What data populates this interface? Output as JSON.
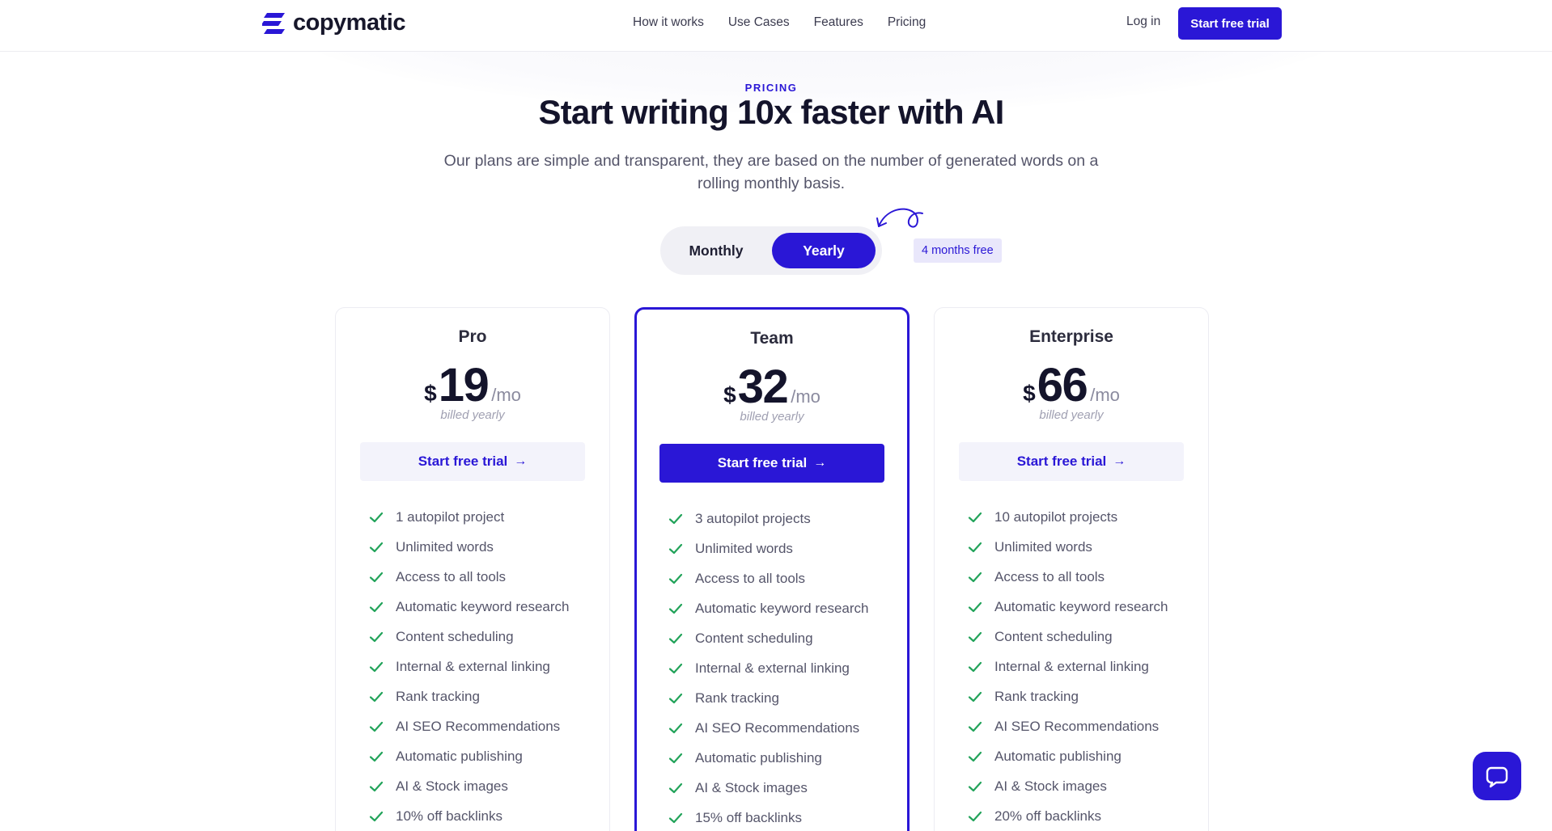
{
  "header": {
    "logo_text": "copymatic",
    "nav": [
      "How it works",
      "Use Cases",
      "Features",
      "Pricing"
    ],
    "login": "Log in",
    "cta": "Start free trial"
  },
  "hero": {
    "eyebrow": "PRICING",
    "title": "Start writing 10x faster with AI",
    "subtitle": "Our plans are simple and transparent, they are based on the number of generated words on a rolling monthly basis."
  },
  "billing_toggle": {
    "monthly": "Monthly",
    "yearly": "Yearly",
    "selected": "Yearly",
    "promo": "4 months free"
  },
  "plans": [
    {
      "name": "Pro",
      "currency": "$",
      "price": "19",
      "period": "/mo",
      "billed": "billed yearly",
      "cta": "Start free trial",
      "features": [
        "1 autopilot project",
        "Unlimited words",
        "Access to all tools",
        "Automatic keyword research",
        "Content scheduling",
        "Internal & external linking",
        "Rank tracking",
        "AI SEO Recommendations",
        "Automatic publishing",
        "AI & Stock images",
        "10% off backlinks"
      ]
    },
    {
      "name": "Team",
      "currency": "$",
      "price": "32",
      "period": "/mo",
      "billed": "billed yearly",
      "cta": "Start free trial",
      "features": [
        "3 autopilot projects",
        "Unlimited words",
        "Access to all tools",
        "Automatic keyword research",
        "Content scheduling",
        "Internal & external linking",
        "Rank tracking",
        "AI SEO Recommendations",
        "Automatic publishing",
        "AI & Stock images",
        "15% off backlinks"
      ]
    },
    {
      "name": "Enterprise",
      "currency": "$",
      "price": "66",
      "period": "/mo",
      "billed": "billed yearly",
      "cta": "Start free trial",
      "features": [
        "10 autopilot projects",
        "Unlimited words",
        "Access to all tools",
        "Automatic keyword research",
        "Content scheduling",
        "Internal & external linking",
        "Rank tracking",
        "AI SEO Recommendations",
        "Automatic publishing",
        "AI & Stock images",
        "20% off backlinks"
      ]
    }
  ],
  "colors": {
    "accent": "#2a17d6",
    "check": "#22a35a",
    "text": "#14142b"
  },
  "icons": {
    "check": "check-icon",
    "arrow": "arrow-right-icon",
    "chat": "chat-bubble-icon"
  }
}
